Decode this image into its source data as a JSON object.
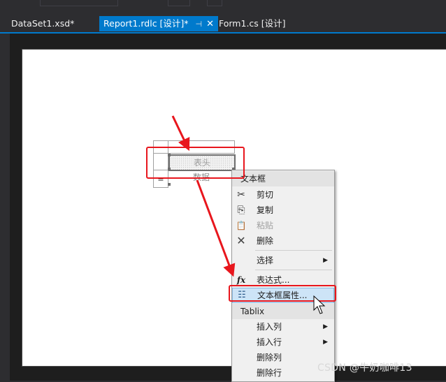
{
  "tabs": [
    {
      "label": "DataSet1.xsd*"
    },
    {
      "label": "Report1.rdlc [设计]*",
      "active": true,
      "pin": "⊣",
      "close": "✕"
    },
    {
      "label": "Form1.cs [设计]"
    }
  ],
  "report": {
    "header_cell": "表头",
    "data_cell": "数据",
    "row_group_marker": "≡"
  },
  "context_menu": {
    "group_textbox": "文本框",
    "cut": "剪切",
    "copy": "复制",
    "paste": "粘贴",
    "delete": "删除",
    "select": "选择",
    "expression": "表达式...",
    "textbox_properties": "文本框属性...",
    "group_tablix": "Tablix",
    "insert_column": "插入列",
    "insert_row": "插入行",
    "delete_column": "删除列",
    "delete_row": "删除行",
    "submenu_arrow": "▶"
  },
  "icons": {
    "cut": "✂",
    "copy": "⎘",
    "paste": "📋",
    "delete": "✕",
    "expression": "fx",
    "properties": "☷"
  },
  "colors": {
    "accent": "#007acc",
    "annotation_red": "#e8161d",
    "menu_highlight": "#cde4f7"
  },
  "watermark": "CSDN @牛奶咖啡13"
}
